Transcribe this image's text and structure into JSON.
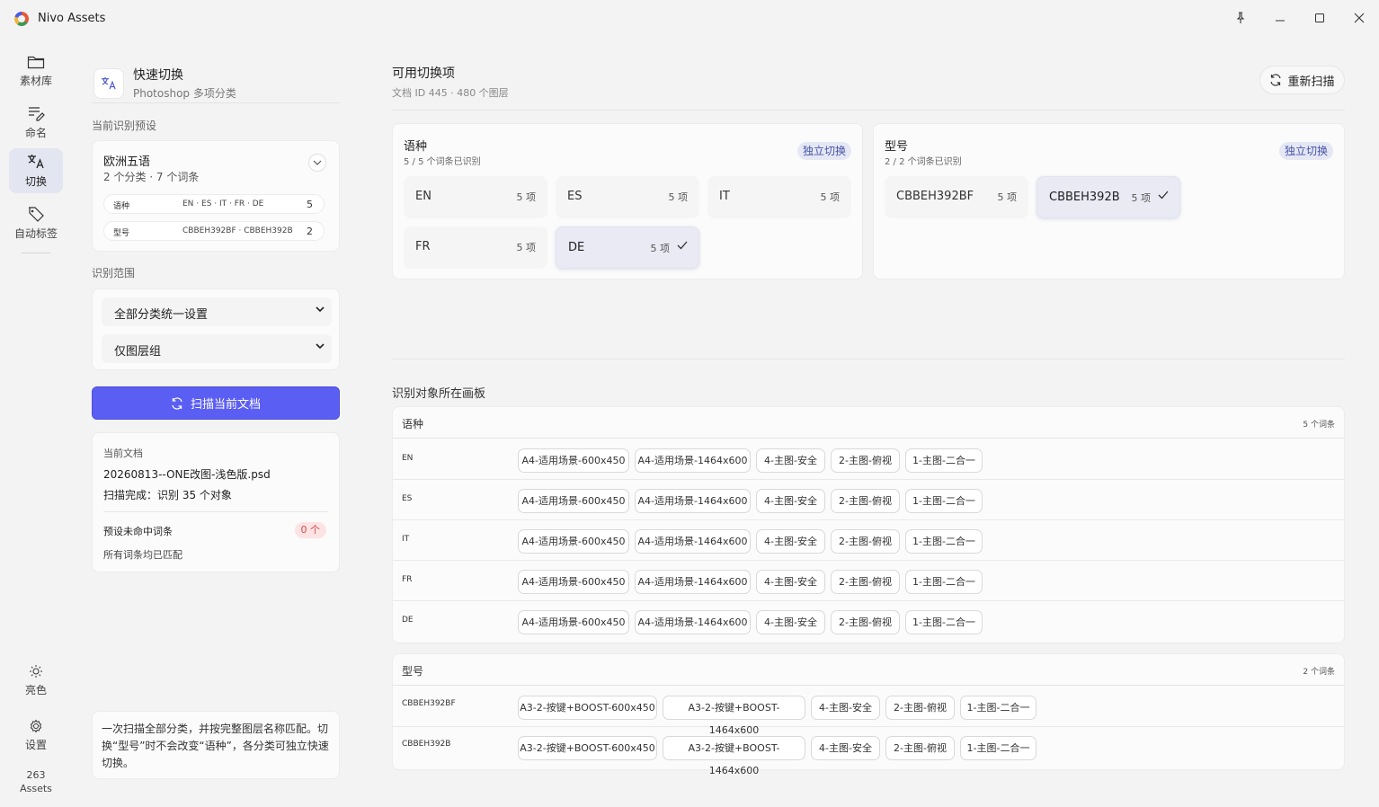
{
  "window": {
    "title": "Nivo Assets"
  },
  "rail": {
    "items": [
      {
        "label": "素材库",
        "icon": "folder-icon"
      },
      {
        "label": "命名",
        "icon": "edit-list-icon"
      },
      {
        "label": "切换",
        "icon": "translate-icon"
      },
      {
        "label": "自动标签",
        "icon": "tag-icon"
      }
    ],
    "theme_label": "亮色",
    "settings_label": "设置",
    "asset_count": "263",
    "asset_unit": "Assets"
  },
  "quick_switch": {
    "title": "快速切换",
    "subtitle": "Photoshop 多项分类"
  },
  "preset": {
    "section_label": "当前识别预设",
    "name": "欧洲五语",
    "meta": "2 个分类 · 7 个词条",
    "rows": [
      {
        "key": "语种",
        "values": "EN · ES · IT · FR · DE",
        "count": "5"
      },
      {
        "key": "型号",
        "values": "CBBEH392BF · CBBEH392B",
        "count": "2"
      }
    ]
  },
  "scope": {
    "section_label": "识别范围",
    "select1": "全部分类统一设置",
    "select2": "仅图层组"
  },
  "scan_button": "扫描当前文档",
  "current_doc": {
    "label": "当前文档",
    "filename": "20260813--ONE改图-浅色版.psd",
    "status": "扫描完成：识别 35 个对象",
    "unmatched_label": "预设未命中词条",
    "unmatched_count": "0 个",
    "unmatched_note": "所有词条均已匹配"
  },
  "tip": "一次扫描全部分类，并按完整图层名称匹配。切换“型号”时不会改变“语种”，各分类可独立快速切换。",
  "right": {
    "title": "可用切换项",
    "subtitle": "文档 ID 445 · 480 个图层",
    "rescan": "重新扫描"
  },
  "groups": [
    {
      "title": "语种",
      "status": "5 / 5 个词条已识别",
      "badge": "独立切换",
      "options": [
        {
          "name": "EN",
          "count": "5 项",
          "selected": false
        },
        {
          "name": "ES",
          "count": "5 项",
          "selected": false
        },
        {
          "name": "IT",
          "count": "5 项",
          "selected": false
        },
        {
          "name": "FR",
          "count": "5 项",
          "selected": false
        },
        {
          "name": "DE",
          "count": "5 项",
          "selected": true
        }
      ]
    },
    {
      "title": "型号",
      "status": "2 / 2 个词条已识别",
      "badge": "独立切换",
      "options": [
        {
          "name": "CBBEH392BF",
          "count": "5 项",
          "selected": false
        },
        {
          "name": "CBBEH392B",
          "count": "5 项",
          "selected": true
        }
      ]
    }
  ],
  "artboards": {
    "title": "识别对象所在画板",
    "tables": [
      {
        "header": "语种",
        "count": "5 个词条",
        "rows": [
          {
            "key": "EN",
            "chips": [
              "A4-适用场景-600x450",
              "A4-适用场景-1464x600",
              "4-主图-安全",
              "2-主图-俯视",
              "1-主图-二合一"
            ]
          },
          {
            "key": "ES",
            "chips": [
              "A4-适用场景-600x450",
              "A4-适用场景-1464x600",
              "4-主图-安全",
              "2-主图-俯视",
              "1-主图-二合一"
            ]
          },
          {
            "key": "IT",
            "chips": [
              "A4-适用场景-600x450",
              "A4-适用场景-1464x600",
              "4-主图-安全",
              "2-主图-俯视",
              "1-主图-二合一"
            ]
          },
          {
            "key": "FR",
            "chips": [
              "A4-适用场景-600x450",
              "A4-适用场景-1464x600",
              "4-主图-安全",
              "2-主图-俯视",
              "1-主图-二合一"
            ]
          },
          {
            "key": "DE",
            "chips": [
              "A4-适用场景-600x450",
              "A4-适用场景-1464x600",
              "4-主图-安全",
              "2-主图-俯视",
              "1-主图-二合一"
            ]
          }
        ]
      },
      {
        "header": "型号",
        "count": "2 个词条",
        "rows": [
          {
            "key": "CBBEH392BF",
            "chips": [
              "A3-2-按键+BOOST-600x450",
              "A3-2-按键+BOOST-1464x600",
              "4-主图-安全",
              "2-主图-俯视",
              "1-主图-二合一"
            ]
          },
          {
            "key": "CBBEH392B",
            "chips": [
              "A3-2-按键+BOOST-600x450",
              "A3-2-按键+BOOST-1464x600",
              "4-主图-安全",
              "2-主图-俯视",
              "1-主图-二合一"
            ]
          }
        ]
      }
    ]
  },
  "colors": {
    "accent": "#5b5ef2",
    "badge_bg": "#e5e8f4",
    "badge_text": "#4553a8",
    "warn_bg": "#fde3e3",
    "warn_text": "#d64a4a"
  }
}
